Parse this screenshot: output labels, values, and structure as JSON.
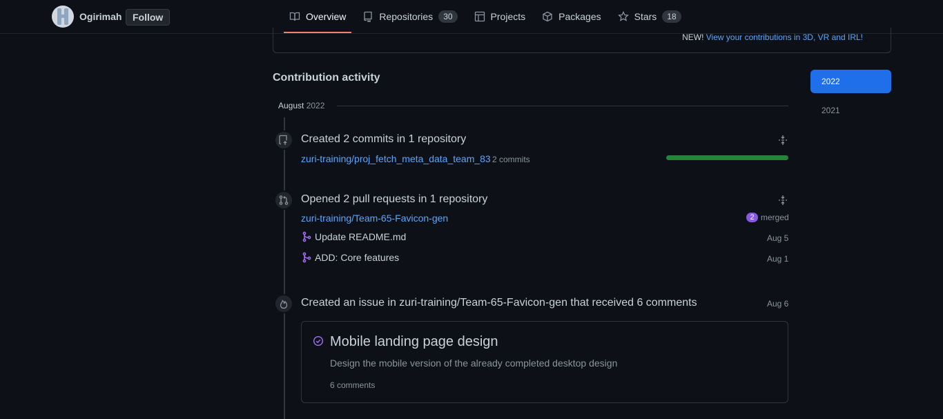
{
  "header": {
    "username": "Ogirimah",
    "follow_label": "Follow",
    "tabs": [
      {
        "label": "Overview",
        "icon": "book-icon",
        "active": true
      },
      {
        "label": "Repositories",
        "icon": "repo-icon",
        "count": "30"
      },
      {
        "label": "Projects",
        "icon": "table-icon"
      },
      {
        "label": "Packages",
        "icon": "package-icon"
      },
      {
        "label": "Stars",
        "icon": "star-icon",
        "count": "18"
      }
    ]
  },
  "graph_footer": {
    "new_label": "NEW!",
    "link_text": "View your contributions in 3D, VR and IRL!"
  },
  "activity": {
    "title": "Contribution activity",
    "month": "August",
    "month_year": "2022",
    "commits": {
      "title": "Created 2 commits in 1 repository",
      "repo": "zuri-training/proj_fetch_meta_data_team_83",
      "count_label": "2 commits",
      "progress": 1.0
    },
    "pull_requests": {
      "title": "Opened 2 pull requests in 1 repository",
      "repo": "zuri-training/Team-65-Favicon-gen",
      "merged_count": "2",
      "merged_label": "merged",
      "items": [
        {
          "title": "Update README.md",
          "date": "Aug 5"
        },
        {
          "title": "ADD: Core features",
          "date": "Aug 1"
        }
      ]
    },
    "issue": {
      "title": "Created an issue in zuri-training/Team-65-Favicon-gen that received 6 comments",
      "date": "Aug 6",
      "card_title": "Mobile landing page design",
      "card_desc": "Design the mobile version of the already completed desktop design",
      "card_comments": "6 comments"
    }
  },
  "years": {
    "selected": "2022",
    "other": "2021"
  },
  "colors": {
    "background": "#0d1117",
    "accent": "#1f6feb",
    "link": "#58a6ff",
    "merged": "#8957e5",
    "progress": "#238636",
    "tab_underline": "#f78166"
  }
}
